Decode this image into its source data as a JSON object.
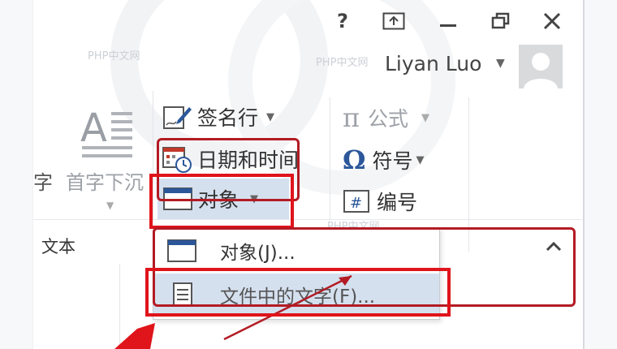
{
  "window": {
    "help": "?",
    "user_name": "Liyan Luo"
  },
  "ribbon": {
    "text_group": {
      "drop_cap_label": "首字下沉",
      "partial_label": "字",
      "section_label": "文本"
    },
    "items": {
      "signature_line": "签名行",
      "date_time": "日期和时间",
      "object": "对象",
      "equation": "公式",
      "symbol": "符号",
      "number": "编号"
    }
  },
  "dropdown_menu": {
    "items": [
      {
        "label": "对象(J)..."
      },
      {
        "label": "文件中的文字(F)..."
      }
    ]
  },
  "watermark": "PHP中文网",
  "colors": {
    "annotation_red": "#e0141b",
    "annotation_dark_red": "#b31b24",
    "highlight": "#d5e0ef",
    "accent_blue": "#2b579a"
  }
}
